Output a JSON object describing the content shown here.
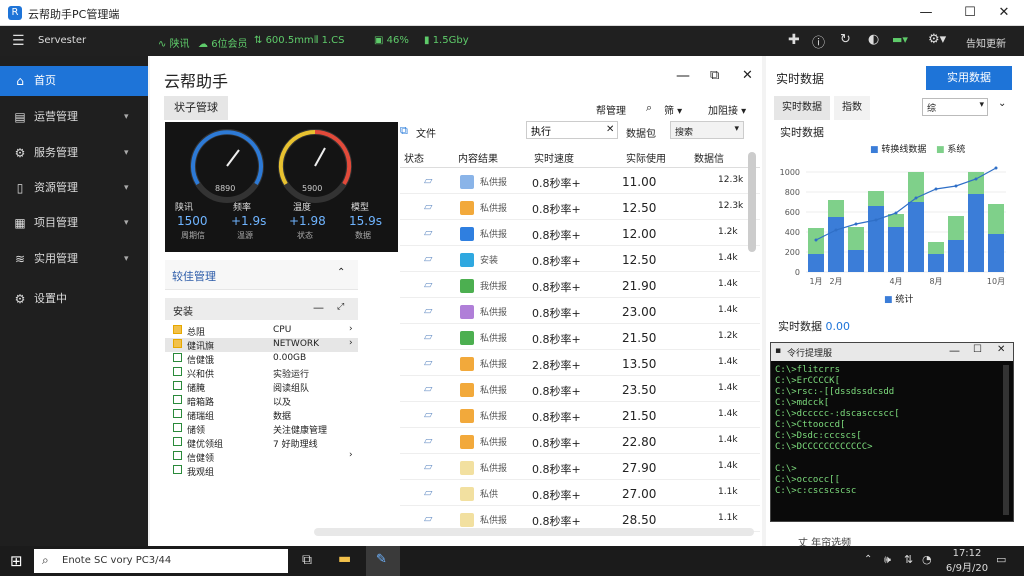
{
  "window": {
    "title": "云帮助手PC管理端",
    "min": "—",
    "max": "☐",
    "close": "✕"
  },
  "topbar": {
    "app_label": "Servester",
    "stats": [
      "陕讯",
      "6位会员",
      "600.5mm",
      "1.CS",
      "46%",
      "1.5Gby"
    ],
    "right_label": "告知更新"
  },
  "sidebar": {
    "items": [
      {
        "icon": "home-icon",
        "glyph": "⌂",
        "label": "首页"
      },
      {
        "icon": "clipboard-icon",
        "glyph": "▤",
        "label": "运营管理"
      },
      {
        "icon": "gear-icon",
        "glyph": "⚙",
        "label": "服务管理"
      },
      {
        "icon": "document-icon",
        "glyph": "▯",
        "label": "资源管理"
      },
      {
        "icon": "grid-icon",
        "glyph": "▦",
        "label": "项目管理"
      },
      {
        "icon": "layers-icon",
        "glyph": "≋",
        "label": "实用管理"
      },
      {
        "icon": "settings-icon",
        "glyph": "⚙",
        "label": "设置中"
      }
    ]
  },
  "main": {
    "title": "云帮助手",
    "tab": "状子管球",
    "toolbar": {
      "manage": "帮管理",
      "filter": "筛",
      "more": "加阻接"
    },
    "gauges": [
      {
        "value": "8890",
        "left_label": "陕讯",
        "left_value": "1500",
        "left_sub": "周期信",
        "right_label": "频率",
        "right_value": "+1.9s",
        "right_sub": "温源"
      },
      {
        "value": "5900",
        "left_label": "温度",
        "left_value": "+1.98",
        "left_sub": "状态",
        "right_label": "模型",
        "right_value": "15.9s",
        "right_sub": "数据"
      }
    ],
    "section_title": "较佳管理",
    "list": {
      "header": "安装",
      "rows": [
        {
          "label": "总阻",
          "value": "CPU"
        },
        {
          "label": "健讯旗",
          "value": "NETWORK"
        },
        {
          "label": "信健饿",
          "value": "0.00GB"
        },
        {
          "label": "兴和供",
          "value": "实验运行"
        },
        {
          "label": "储腌",
          "value": "阅读组队"
        },
        {
          "label": "暗箱路",
          "value": "以及"
        },
        {
          "label": "储瑞组",
          "value": "数据"
        },
        {
          "label": "储领",
          "value": "关注健康管理"
        },
        {
          "label": "健优领组",
          "value": "7 好助理线"
        },
        {
          "label": "信健领",
          "value": ""
        },
        {
          "label": "我观组",
          "value": ""
        }
      ]
    },
    "table": {
      "search_label": "文件",
      "search_value": "执行",
      "search_placeholder": "搜索",
      "sort_label": "数据包",
      "columns": [
        "状态",
        "内容结果",
        "实时速度",
        "实际使用",
        "数据信"
      ],
      "rows": [
        {
          "name": "私供报",
          "speed": "0.8秒率+",
          "usage": "11.00",
          "size": "12.3k"
        },
        {
          "name": "私供报",
          "speed": "0.8秒率+",
          "usage": "12.50",
          "size": "12.3k"
        },
        {
          "name": "私供报",
          "speed": "0.8秒率+",
          "usage": "12.00",
          "size": "1.2k"
        },
        {
          "name": "安装",
          "speed": "0.8秒率+",
          "usage": "12.50",
          "size": "1.4k"
        },
        {
          "name": "我供报",
          "speed": "0.8秒率+",
          "usage": "21.90",
          "size": "1.4k"
        },
        {
          "name": "私供报",
          "speed": "0.8秒率+",
          "usage": "23.00",
          "size": "1.4k"
        },
        {
          "name": "私供报",
          "speed": "0.8秒率+",
          "usage": "21.50",
          "size": "1.2k"
        },
        {
          "name": "私供报",
          "speed": "2.8秒率+",
          "usage": "13.50",
          "size": "1.4k"
        },
        {
          "name": "私供报",
          "speed": "0.8秒率+",
          "usage": "23.50",
          "size": "1.4k"
        },
        {
          "name": "私供报",
          "speed": "0.8秒率+",
          "usage": "21.50",
          "size": "1.4k"
        },
        {
          "name": "私供报",
          "speed": "0.8秒率+",
          "usage": "22.80",
          "size": "1.4k"
        },
        {
          "name": "私供报",
          "speed": "0.8秒率+",
          "usage": "27.90",
          "size": "1.4k"
        },
        {
          "name": "私供",
          "speed": "0.8秒率+",
          "usage": "27.00",
          "size": "1.1k"
        },
        {
          "name": "私供报",
          "speed": "0.8秒率+",
          "usage": "28.50",
          "size": "1.1k"
        }
      ],
      "icon_colors": [
        "#8ab4e8",
        "#f2a93b",
        "#2f7fe0",
        "#2fa8e0",
        "#4caf50",
        "#b07fd8",
        "#4caf50",
        "#f2a93b",
        "#f2a93b",
        "#f2a93b",
        "#f2a93b",
        "#f2e0a0",
        "#f2e0a0",
        "#f2e0a0"
      ]
    }
  },
  "right": {
    "button": "实用数据",
    "header": "实时数据",
    "tabs": [
      "实时数据",
      "指数"
    ],
    "dropdown": "综",
    "chart_title": "实时数据",
    "legend": [
      "转换线数据",
      "系统"
    ],
    "footer_legend": "统计",
    "realtime_label": "实时数据",
    "realtime_value": "0.00",
    "console_title": "令行提理服",
    "console_lines": [
      "C:\\>flitcrrs",
      "C:\\>ErCCCCK[",
      "C:\\>rsc:-[[dssdssdcsdd",
      "C:\\>mdcck[",
      "C:\\>dccccc-:dscasccscc[",
      "C:\\>Cttooccd[",
      "C:\\>Dsdc:cccscs[",
      "C:\\>DCCCCCCCCCCCC>",
      "",
      "C:\\>",
      "C:\\>occocc[[",
      "C:\\>c:cscscscsc"
    ],
    "footer": "丈 年帘选频"
  },
  "chart_data": {
    "type": "bar",
    "title": "实时数据",
    "categories": [
      "1月",
      "2月",
      "",
      "",
      "4月",
      "",
      "8月",
      "",
      "",
      "10月"
    ],
    "series": [
      {
        "name": "转换线数据",
        "values": [
          180,
          550,
          220,
          660,
          450,
          700,
          180,
          320,
          780,
          380
        ]
      },
      {
        "name": "系统",
        "values": [
          260,
          170,
          230,
          150,
          130,
          1300,
          120,
          240,
          360,
          300
        ]
      }
    ],
    "line": [
      320,
      420,
      480,
      520,
      590,
      740,
      830,
      860,
      930,
      1040
    ],
    "ylim": [
      0,
      1000
    ],
    "yticks": [
      0,
      200,
      400,
      600,
      800,
      1000
    ],
    "colors": [
      "#3b7dd8",
      "#7fd08a"
    ]
  },
  "taskbar": {
    "search_text": "Enote SC vory PC3/44",
    "time": "17:12",
    "date": "6/9月/20"
  }
}
